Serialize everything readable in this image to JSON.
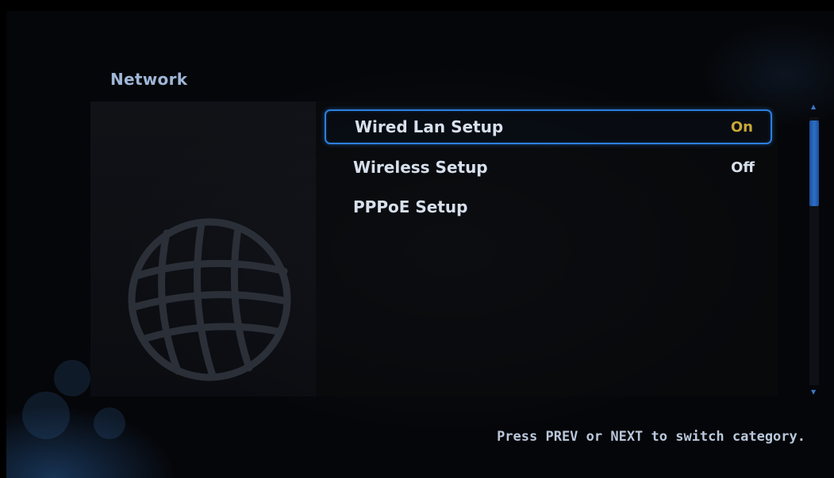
{
  "screen": {
    "title": "Network",
    "hint": "Press PREV or NEXT to switch category."
  },
  "menu": {
    "items": [
      {
        "label": "Wired Lan Setup",
        "value": "On",
        "selected": true
      },
      {
        "label": "Wireless Setup",
        "value": "Off",
        "selected": false
      },
      {
        "label": "PPPoE Setup",
        "value": "",
        "selected": false
      }
    ]
  },
  "icons": {
    "category_icon": "globe-icon",
    "scroll_up": "triangle-up-icon",
    "scroll_down": "triangle-down-icon"
  },
  "colors": {
    "accent": "#2c7fe0",
    "selected_value": "#c8a838",
    "title": "#9fb6d6",
    "text": "#d7e0ec"
  }
}
